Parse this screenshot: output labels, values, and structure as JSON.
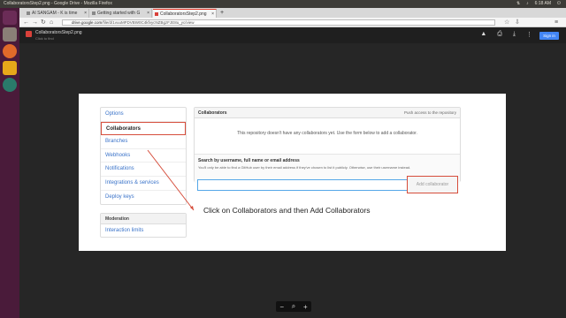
{
  "os": {
    "window_title": "CollaboratorsStep2.png - Google Drive - Mozilla Firefox",
    "time": "6:18 AM"
  },
  "browser": {
    "tabs": [
      {
        "label": "AI SANGAM - K is time"
      },
      {
        "label": "Getting started with G"
      },
      {
        "label": "CollaboratorsStep2.png"
      }
    ],
    "new_tab": "+",
    "url_host": "drive.google.com",
    "url_path": "/file/d/1vuuMFDVBW0C4kfvycNZBgzFJE8u_yc/view"
  },
  "viewer": {
    "file_name": "CollaboratorsStep2.png",
    "hint": "Click to find",
    "sign_in": "Sign in",
    "zoom_minus": "−",
    "zoom_plus": "+"
  },
  "settings": {
    "menu": [
      "Options",
      "Collaborators",
      "Branches",
      "Webhooks",
      "Notifications",
      "Integrations & services",
      "Deploy keys"
    ],
    "moderation_head": "Moderation",
    "moderation_items": [
      "Interaction limits"
    ],
    "panel_title": "Collaborators",
    "panel_right": "Push access to the repository",
    "empty_text": "This repository doesn't have any collaborators yet. Use the form below to add a collaborator.",
    "search_label": "Search by username, full name or email address",
    "search_note": "You'll only be able to find a GitHub user by their email address if they've chosen to list it publicly. Otherwise, use their username instead.",
    "add_button": "Add collaborator",
    "caption": "Click on Collaborators and then Add Collaborators"
  },
  "colors": {
    "highlight": "#d64d3b",
    "link": "#3a73c9",
    "signin": "#4285f4"
  }
}
